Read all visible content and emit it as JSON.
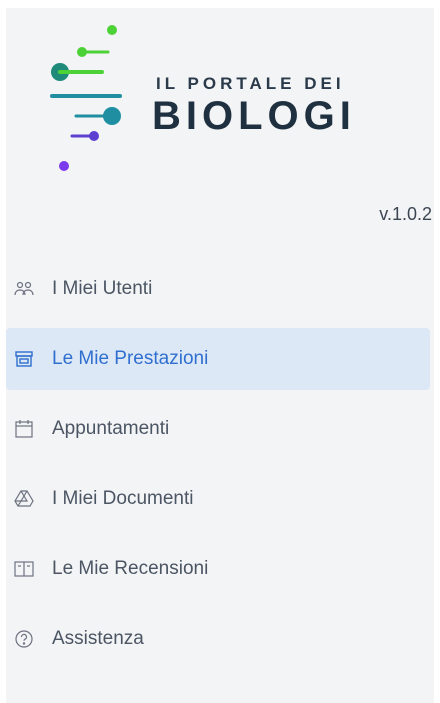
{
  "brand": {
    "line1": "IL PORTALE DEI",
    "line2": "BIOLOGI"
  },
  "version": "v.1.0.2",
  "colors": {
    "active_bg": "#dde8f6",
    "active_text": "#2f6fcf",
    "green": "#4cd137",
    "teal": "#1f8ea0",
    "purple": "#7c3aed"
  },
  "menu": [
    {
      "label": "I Miei Utenti",
      "icon": "users-icon",
      "active": false
    },
    {
      "label": "Le Mie Prestazioni",
      "icon": "store-icon",
      "active": true
    },
    {
      "label": "Appuntamenti",
      "icon": "calendar-icon",
      "active": false
    },
    {
      "label": "I Miei Documenti",
      "icon": "drive-icon",
      "active": false
    },
    {
      "label": "Le Mie Recensioni",
      "icon": "book-icon",
      "active": false
    },
    {
      "label": "Assistenza",
      "icon": "help-icon",
      "active": false
    }
  ]
}
